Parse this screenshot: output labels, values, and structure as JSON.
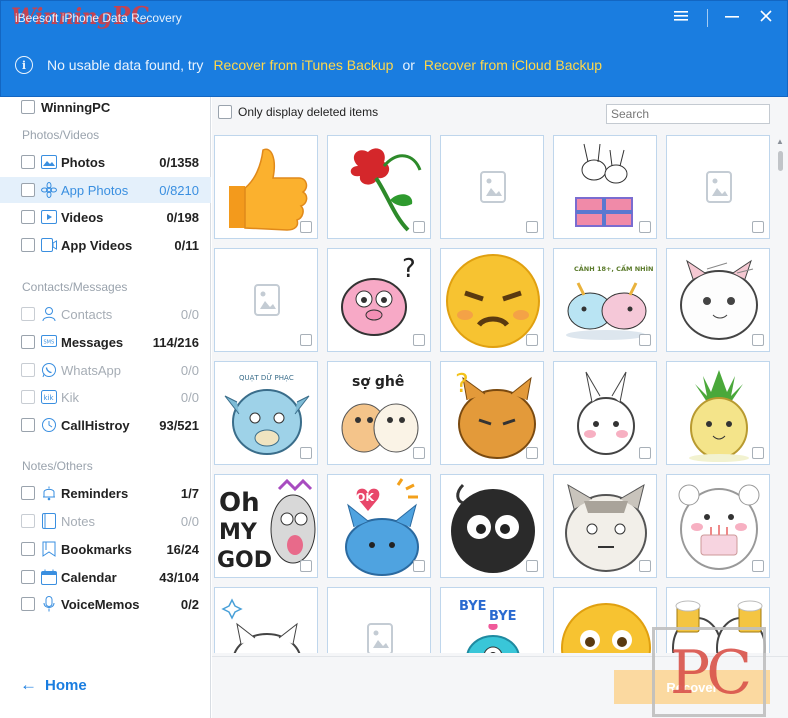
{
  "app": {
    "title": "iBeesoft iPhone Data Recovery",
    "watermark_a": "Winning",
    "watermark_b": "PC"
  },
  "window_controls": [
    {
      "name": "menu-icon",
      "glyph": "☰"
    },
    {
      "name": "minimize-icon",
      "glyph": "—"
    },
    {
      "name": "close-icon",
      "glyph": "✕"
    }
  ],
  "banner": {
    "message": "No usable data found, try",
    "link_itunes": "Recover from iTunes Backup",
    "or": "or",
    "link_icloud": "Recover from iCloud Backup"
  },
  "sidebar": {
    "root_label": "WinningPC",
    "sections": {
      "photos": "Photos/Videos",
      "contacts": "Contacts/Messages",
      "notes": "Notes/Others"
    },
    "items": [
      {
        "label": "Photos",
        "count": "0/1358",
        "icon": "photo-icon",
        "state": "normal"
      },
      {
        "label": "App Photos",
        "count": "0/8210",
        "icon": "app-photo-icon",
        "state": "selected"
      },
      {
        "label": "Videos",
        "count": "0/198",
        "icon": "video-icon",
        "state": "normal"
      },
      {
        "label": "App Videos",
        "count": "0/11",
        "icon": "app-video-icon",
        "state": "normal"
      },
      {
        "label": "Contacts",
        "count": "0/0",
        "icon": "contact-icon",
        "state": "disabled"
      },
      {
        "label": "Messages",
        "count": "114/216",
        "icon": "sms-icon",
        "state": "normal"
      },
      {
        "label": "WhatsApp",
        "count": "0/0",
        "icon": "whatsapp-icon",
        "state": "disabled"
      },
      {
        "label": "Kik",
        "count": "0/0",
        "icon": "kik-icon",
        "state": "disabled"
      },
      {
        "label": "CallHistroy",
        "count": "93/521",
        "icon": "call-history-icon",
        "state": "normal"
      },
      {
        "label": "Reminders",
        "count": "1/7",
        "icon": "bell-icon",
        "state": "normal"
      },
      {
        "label": "Notes",
        "count": "0/0",
        "icon": "notes-icon",
        "state": "disabled"
      },
      {
        "label": "Bookmarks",
        "count": "16/24",
        "icon": "bookmark-icon",
        "state": "normal"
      },
      {
        "label": "Calendar",
        "count": "43/104",
        "icon": "calendar-icon",
        "state": "normal"
      },
      {
        "label": "VoiceMemos",
        "count": "0/2",
        "icon": "microphone-icon",
        "state": "normal"
      }
    ],
    "home_label": "Home"
  },
  "toolbar": {
    "only_deleted_label": "Only display deleted items",
    "search_placeholder": "Search"
  },
  "grid": {
    "tiles": [
      {
        "kind": "thumbs-up"
      },
      {
        "kind": "rose"
      },
      {
        "kind": "placeholder"
      },
      {
        "kind": "bunnies-gift"
      },
      {
        "kind": "placeholder"
      },
      {
        "kind": "placeholder"
      },
      {
        "kind": "pink-pig-question"
      },
      {
        "kind": "angry-emoji"
      },
      {
        "kind": "unicorns-text",
        "caption": "CẢNH 18+, CẤM NHÌN"
      },
      {
        "kind": "cat-lying"
      },
      {
        "kind": "dragon",
        "caption": "QUẠT DỮ PHẠC"
      },
      {
        "kind": "cats-scared",
        "caption": "sợ ghê"
      },
      {
        "kind": "tabby-cat-question"
      },
      {
        "kind": "bunny-blush"
      },
      {
        "kind": "pineapple"
      },
      {
        "kind": "oh-my-god",
        "caption": "Oh MY GOD"
      },
      {
        "kind": "blue-cat-ok",
        "caption": "OK"
      },
      {
        "kind": "black-ball"
      },
      {
        "kind": "grumpy-cat"
      },
      {
        "kind": "bear-cake"
      },
      {
        "kind": "white-cat-sparkle"
      },
      {
        "kind": "placeholder"
      },
      {
        "kind": "bye-bye",
        "caption": "BYE BYE"
      },
      {
        "kind": "surprised-emoji"
      },
      {
        "kind": "bear-beer"
      }
    ]
  },
  "footer": {
    "recover_label": "Recover",
    "pc_watermark": "PC"
  },
  "colors": {
    "accent": "#1a7de0",
    "link_yellow": "#ffd84a",
    "selected_bg": "#e4f0fb",
    "recover_bg": "#fbd9a0"
  }
}
